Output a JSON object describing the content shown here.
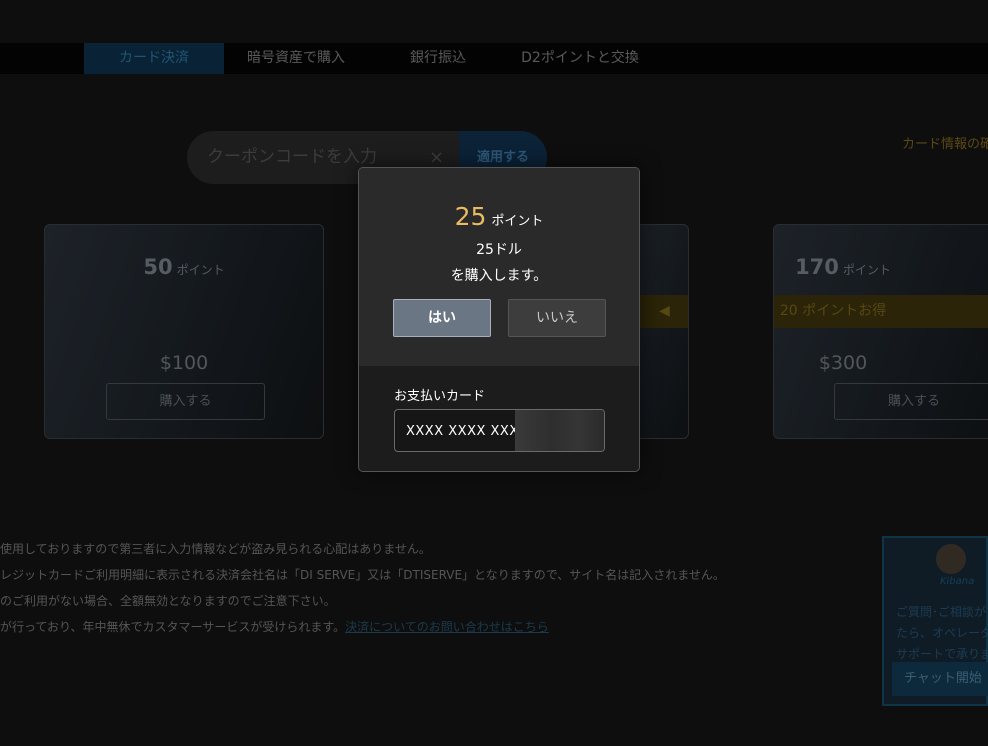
{
  "tabs": [
    {
      "label": "カード決済",
      "active": true
    },
    {
      "label": "暗号資産で購入",
      "active": false
    },
    {
      "label": "銀行振込",
      "active": false
    },
    {
      "label": "D2ポイントと交換",
      "active": false
    }
  ],
  "coupon": {
    "placeholder": "クーポンコードを入力",
    "clear_icon": "×",
    "apply_label": "適用する"
  },
  "card_info_link": "カード情報の確",
  "packages": [
    {
      "points": "50",
      "unit": "ポイント",
      "bonus": "",
      "price": "$100",
      "buy_label": "購入する"
    },
    {
      "points": "",
      "unit": "",
      "bonus": "",
      "price": "",
      "buy_label": ""
    },
    {
      "points": "170",
      "unit": "ポイント",
      "bonus": "20 ポイントお得",
      "price": "$300",
      "buy_label": "購入する"
    }
  ],
  "notes": {
    "line1": "使用しておりますので第三者に入力情報などが盗み見られる心配はありません。",
    "line2": "レジットカードご利用明細に表示される決済会社名は「DI SERVE」又は「DTISERVE」となりますので、サイト名は記入されません。",
    "line3": "のご利用がない場合、全額無効となりますのでご注意下さい。",
    "line4": "が行っており、年中無休でカスタマーサービスが受けられます。",
    "link": "決済についてのお問い合わせはこちら"
  },
  "chat_widget": {
    "badge": "Kibana",
    "line1": "ご質問･ご相談が",
    "line2": "たら、オペレータ",
    "line3": "サポートで承りま",
    "start_label": "チャット開始"
  },
  "modal": {
    "points_value": "25",
    "points_unit": "ポイント",
    "price_line": "25ドル",
    "confirm_line": "を購入します。",
    "yes_label": "はい",
    "no_label": "いいえ",
    "card_label": "お支払いカード",
    "card_value": "XXXX XXXX XXXX"
  },
  "colors": {
    "accent_points": "#e9bb63",
    "yes_button": "#6b7684"
  }
}
